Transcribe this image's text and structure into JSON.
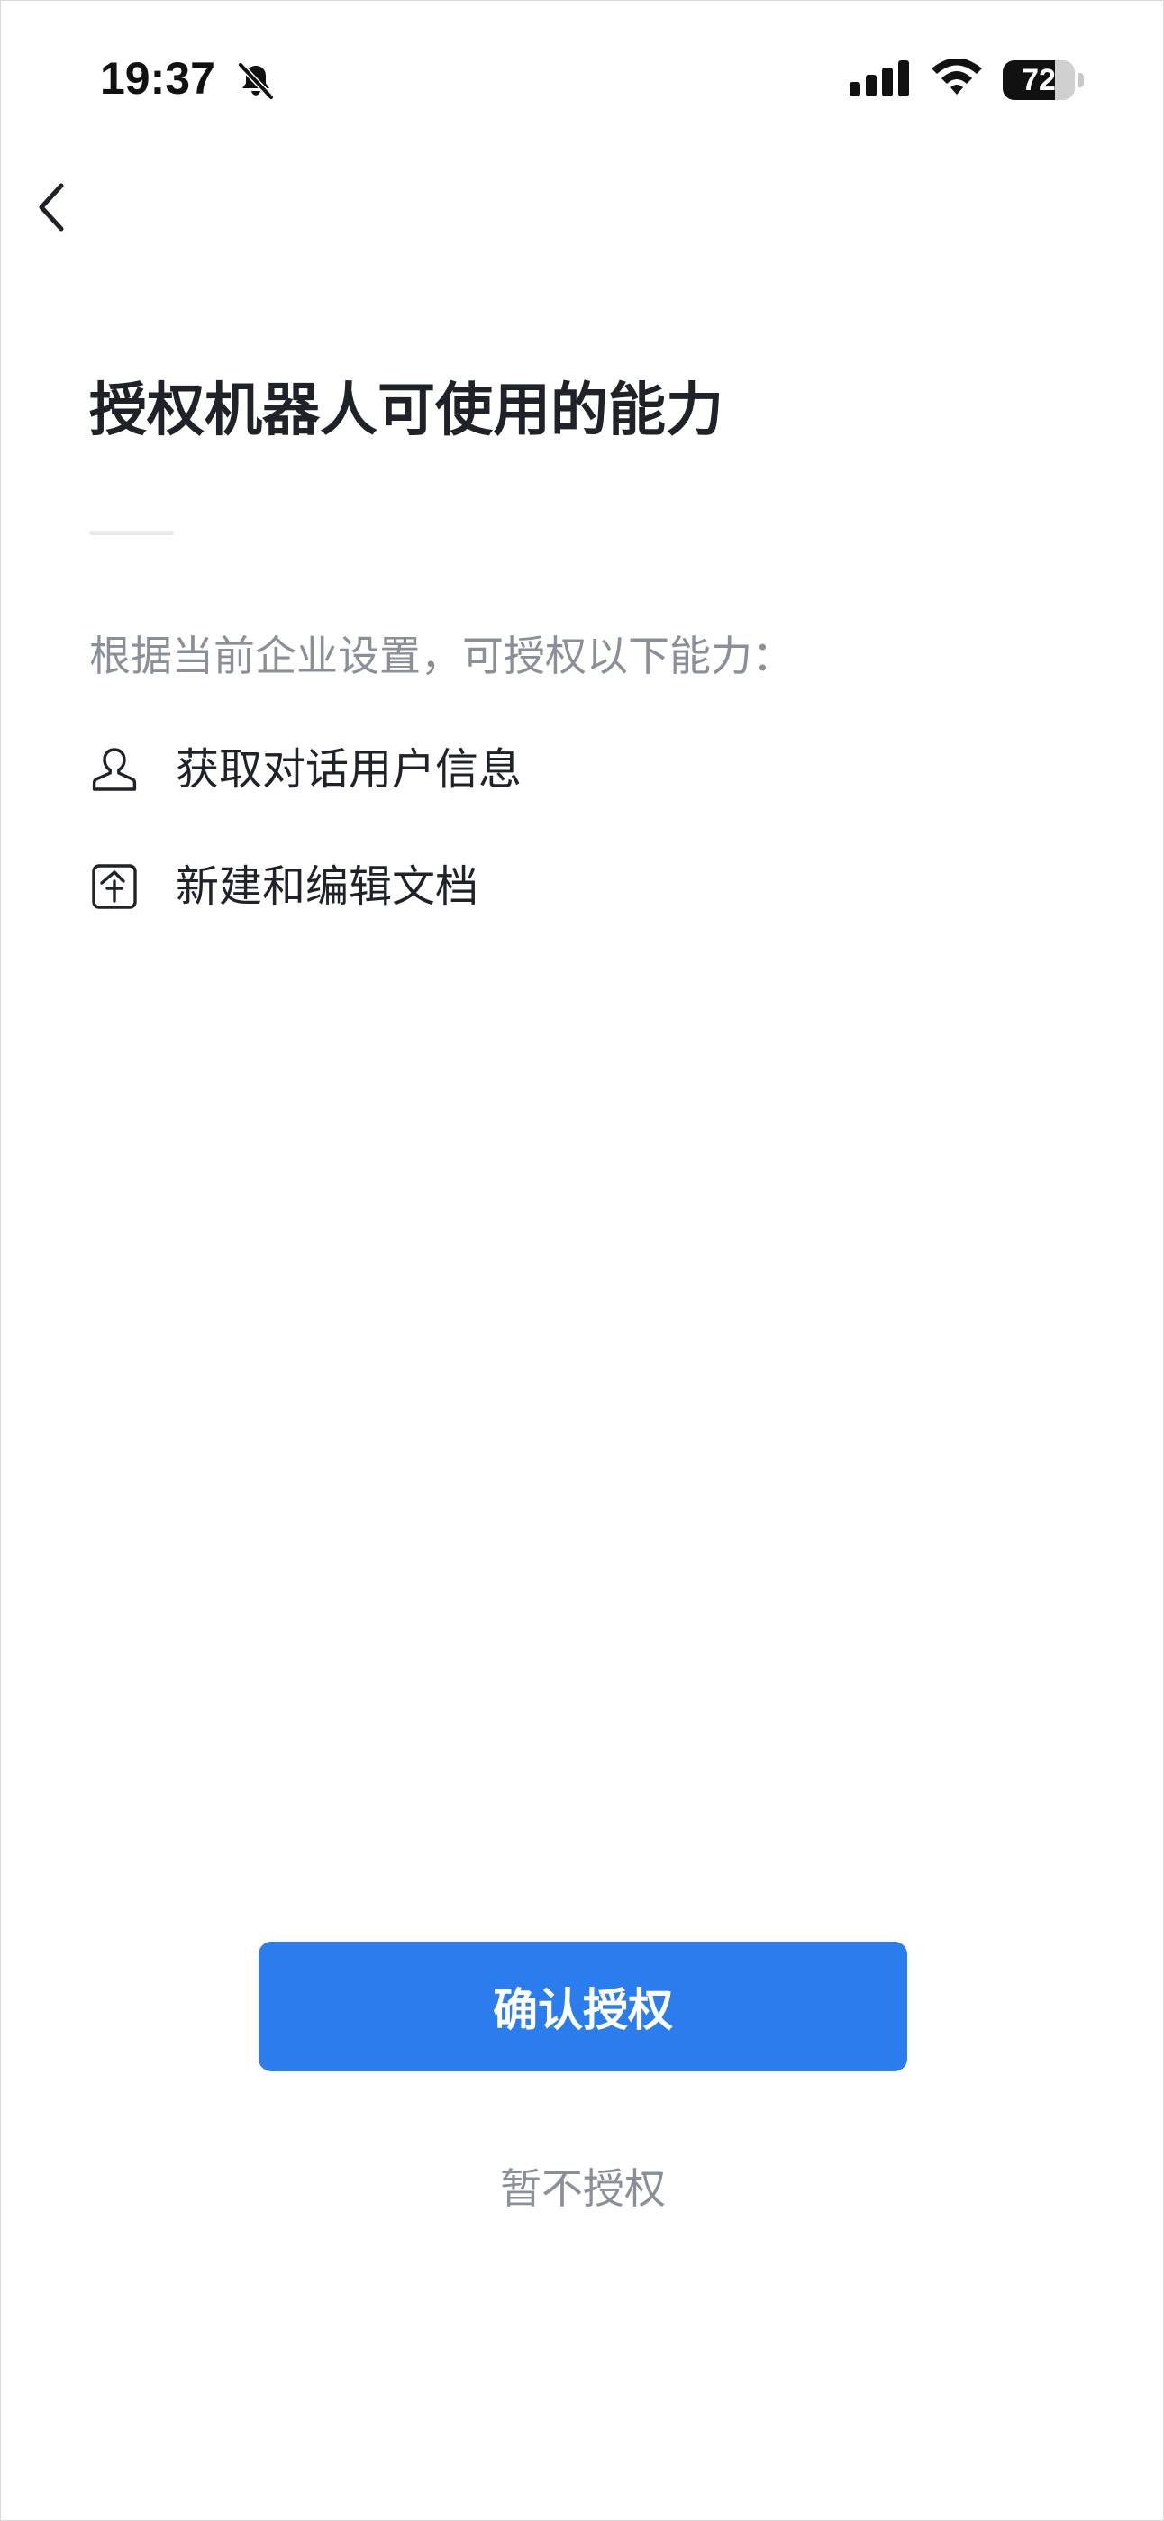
{
  "status_bar": {
    "time": "19:37",
    "battery_level": "72",
    "icons": [
      "bell-off-icon",
      "signal-icon",
      "wifi-icon",
      "battery-icon"
    ]
  },
  "nav": {
    "back_icon": "chevron-left-icon"
  },
  "main": {
    "title": "授权机器人可使用的能力",
    "intro": "根据当前企业设置，可授权以下能力：",
    "capabilities": [
      {
        "icon": "user-icon",
        "label": "获取对话用户信息"
      },
      {
        "icon": "edit-document-icon",
        "label": "新建和编辑文档"
      }
    ]
  },
  "actions": {
    "confirm_label": "确认授权",
    "decline_label": "暂不授权"
  },
  "colors": {
    "primary": "#2b7ded",
    "title_text": "#1f2329",
    "secondary_text": "#8a8f99",
    "divider": "#e6e8eb"
  }
}
